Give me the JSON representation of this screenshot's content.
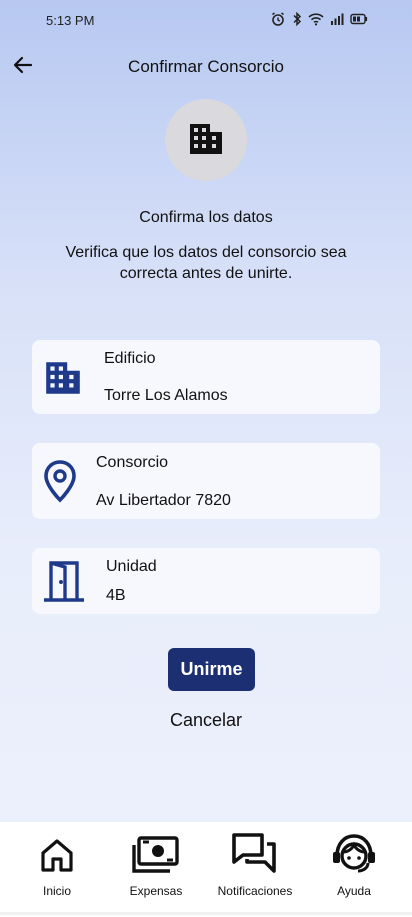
{
  "status_bar": {
    "time": "5:13 PM",
    "icons": [
      "alarm-icon",
      "bluetooth-icon",
      "wifi-icon",
      "signal-icon",
      "battery-icon"
    ]
  },
  "header": {
    "title": "Confirmar Consorcio",
    "back_icon": "arrow-left-icon"
  },
  "hero": {
    "icon": "building-icon",
    "heading": "Confirma los datos",
    "description": "Verifica que los datos del consorcio sea correcta antes de unirte."
  },
  "cards": [
    {
      "icon": "building-icon",
      "label": "Edificio",
      "value": "Torre Los Alamos"
    },
    {
      "icon": "location-pin-icon",
      "label": "Consorcio",
      "value": "Av Libertador 7820"
    },
    {
      "icon": "door-icon",
      "label": "Unidad",
      "value": "4B"
    }
  ],
  "actions": {
    "confirm_label": "Unirme",
    "cancel_label": "Cancelar"
  },
  "bottom_nav": [
    {
      "icon": "home-icon",
      "label": "Inicio"
    },
    {
      "icon": "money-icon",
      "label": "Expensas"
    },
    {
      "icon": "chat-icon",
      "label": "Notificaciones"
    },
    {
      "icon": "support-agent-icon",
      "label": "Ayuda"
    }
  ],
  "colors": {
    "accent": "#1b2f72",
    "icon_blue": "#1f3a8a",
    "background_top": "#b7c8f1",
    "background_bottom": "#eef1fc"
  }
}
